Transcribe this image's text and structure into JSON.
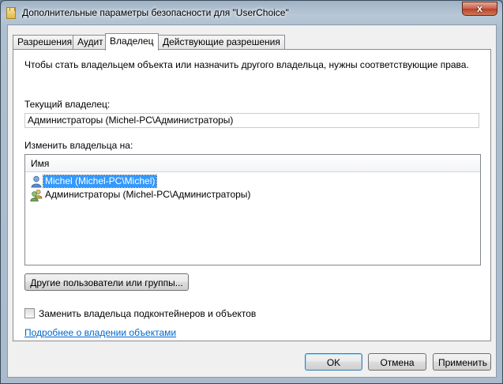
{
  "window": {
    "title": "Дополнительные параметры безопасности  для \"UserChoice\"",
    "close_glyph": "x"
  },
  "tabs": [
    {
      "label": "Разрешения",
      "active": false
    },
    {
      "label": "Аудит",
      "active": false
    },
    {
      "label": "Владелец",
      "active": true
    },
    {
      "label": "Действующие разрешения",
      "active": false
    }
  ],
  "owner_tab": {
    "info_text": "Чтобы стать владельцем объекта или назначить другого владельца, нужны соответствующие права.",
    "current_owner_label": "Текущий владелец:",
    "current_owner_value": "Администраторы (Michel-PC\\Администраторы)",
    "change_owner_label": "Изменить владельца на:",
    "list_header_name": "Имя",
    "list_items": [
      {
        "name": "Michel (Michel-PC\\Michel)",
        "icon": "user-icon",
        "selected": true
      },
      {
        "name": "Администраторы (Michel-PC\\Администраторы)",
        "icon": "group-icon",
        "selected": false
      }
    ],
    "other_users_button": "Другие пользователи или группы...",
    "replace_checkbox_label": "Заменить владельца подконтейнеров и объектов",
    "replace_checkbox_checked": false,
    "learn_more_link": "Подробнее о владении объектами"
  },
  "buttons": {
    "ok": "OK",
    "cancel": "Отмена",
    "apply": "Применить"
  }
}
